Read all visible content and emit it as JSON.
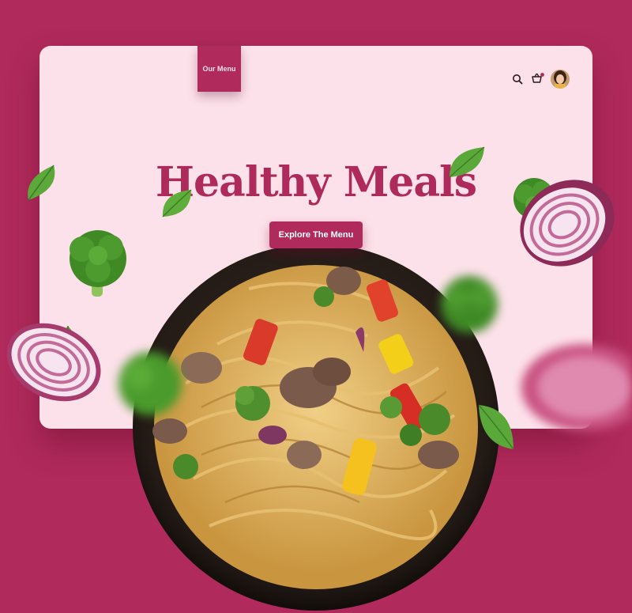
{
  "nav": {
    "menu_tab_label": "Our Menu",
    "search_icon": "search-icon",
    "cart_icon": "basket-icon",
    "avatar_icon": "user-avatar"
  },
  "hero": {
    "title": "Healthy Meals",
    "cta_label": "Explore The Menu"
  },
  "colors": {
    "brand": "#b02a5b",
    "card_bg": "#fde1ea",
    "title": "#ad2a5a"
  }
}
